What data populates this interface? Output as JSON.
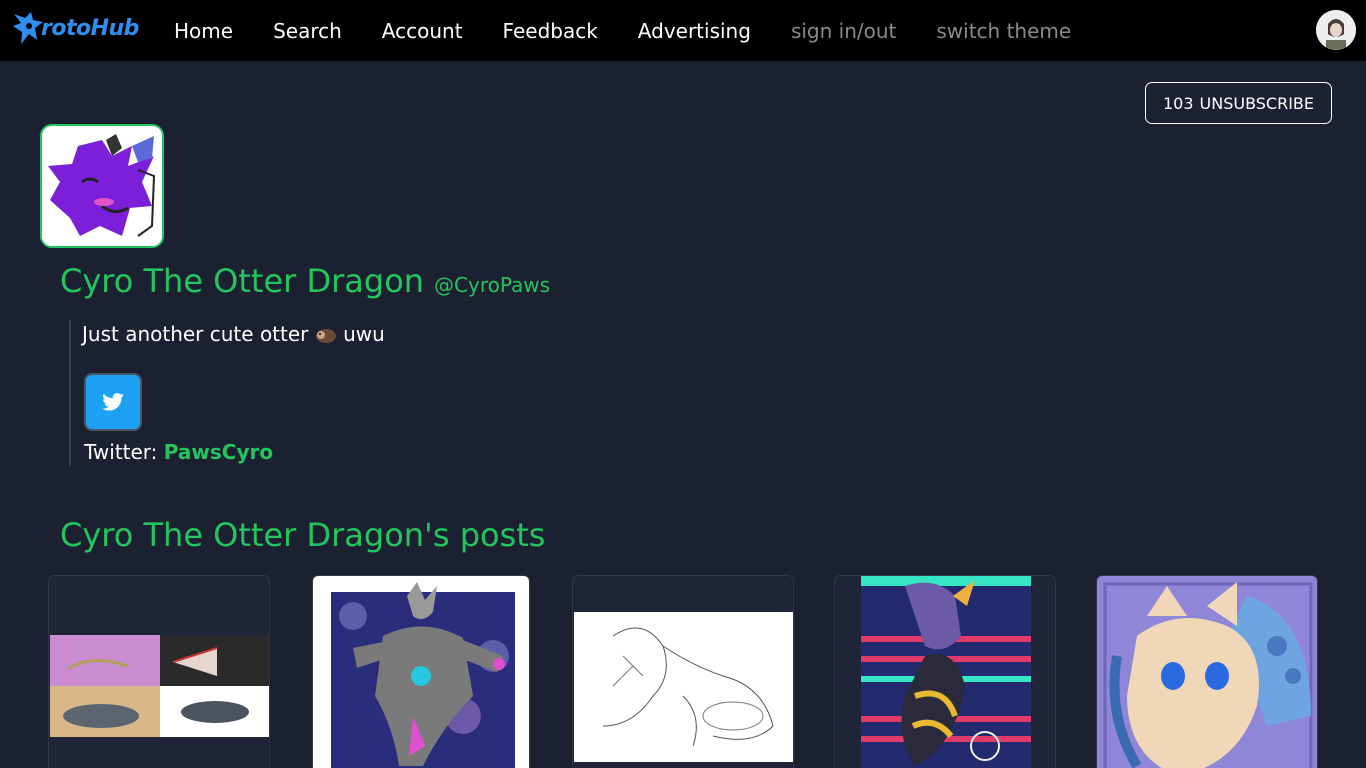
{
  "nav": {
    "logo_text": "rotoHub",
    "links": [
      "Home",
      "Search",
      "Account",
      "Feedback",
      "Advertising"
    ],
    "muted_links": [
      "sign in/out",
      "switch theme"
    ]
  },
  "subscribe": {
    "count": "103",
    "label": "UNSUBSCRIBE"
  },
  "profile": {
    "name": "Cyro The Otter Dragon",
    "handle": "@CyroPaws",
    "bio_before": "Just another cute otter",
    "bio_after": "uwu",
    "twitter_label": "Twitter:",
    "twitter_handle": "PawsCyro"
  },
  "posts": {
    "title": "Cyro The Otter Dragon's posts"
  },
  "colors": {
    "accent": "#22c55e",
    "background": "#1c2131",
    "navbar": "#000000",
    "twitter": "#1da1f2"
  },
  "icons": [
    "protogen-logo-icon",
    "user-avatar-icon",
    "otter-emoji-icon",
    "twitter-icon"
  ]
}
